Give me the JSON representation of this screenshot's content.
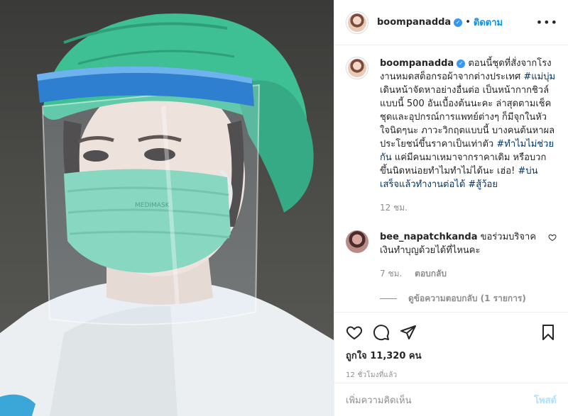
{
  "header": {
    "username": "boompanadda",
    "separator": "•",
    "follow_label": "ติดตาม",
    "more_label": "•••"
  },
  "caption": {
    "username": "boompanadda",
    "text_1": "ตอนนี้ชุดที่สั่งจากโรงงานหมดสต็อกรอผ้าจากต่างประเทศ ",
    "tag_1": "#แม่บุ่ม",
    "text_2": " เดินหน้าจัดหาอย่างอื่นต่อ เป็นหน้ากากชิวล์แบบนี้ 500 อันเบื้องต้นนะคะ ล่าสุดตามเช็คชุดและอุปกรณ์การแพทย์ต่างๆ ก็มีจุกในหัวใจนิดๆนะ ภาวะวิกฤตแบบนี้ บางคนต้นหาผลประโยชน์ขึ้นราคาเป็นเท่าตัว ",
    "tag_2": "#ทำไมไม่ช่วยกัน",
    "text_3": " แค่มีคนมาเหมาจากราคาเดิม หรือบวกขึ้นนิดหน่อยทำไมทำไม่ได้นะ เฮ่อ! ",
    "tag_3": "#บ่นเสร็จแล้วทำงานต่อได้",
    "text_4": " ",
    "tag_4": "#สู้ว้อย",
    "time": "12 ชม."
  },
  "comment": {
    "username": "bee_napatchkanda",
    "text": " ขอร่วมบริจาคเงินทำบุญด้วยได้ที่ไหนคะ",
    "time": "7 ชม.",
    "reply_label": "ตอบกลับ",
    "view_replies": "ดูข้อความตอบกลับ (1 รายการ)"
  },
  "actions": {
    "likes": "ถูกใจ 11,320 คน",
    "timestamp": "12 ชั่วโมงที่แล้ว"
  },
  "add_comment": {
    "placeholder": "เพิ่มความคิดเห็น",
    "post_label": "โพสต์"
  },
  "media": {
    "mask_text": "MEDIMASK"
  },
  "colors": {
    "accent": "#0095f6",
    "hashtag": "#00376b",
    "muted": "#8e8e8e",
    "cap": "#3fbf94",
    "visor_band": "#2f7fd0"
  }
}
